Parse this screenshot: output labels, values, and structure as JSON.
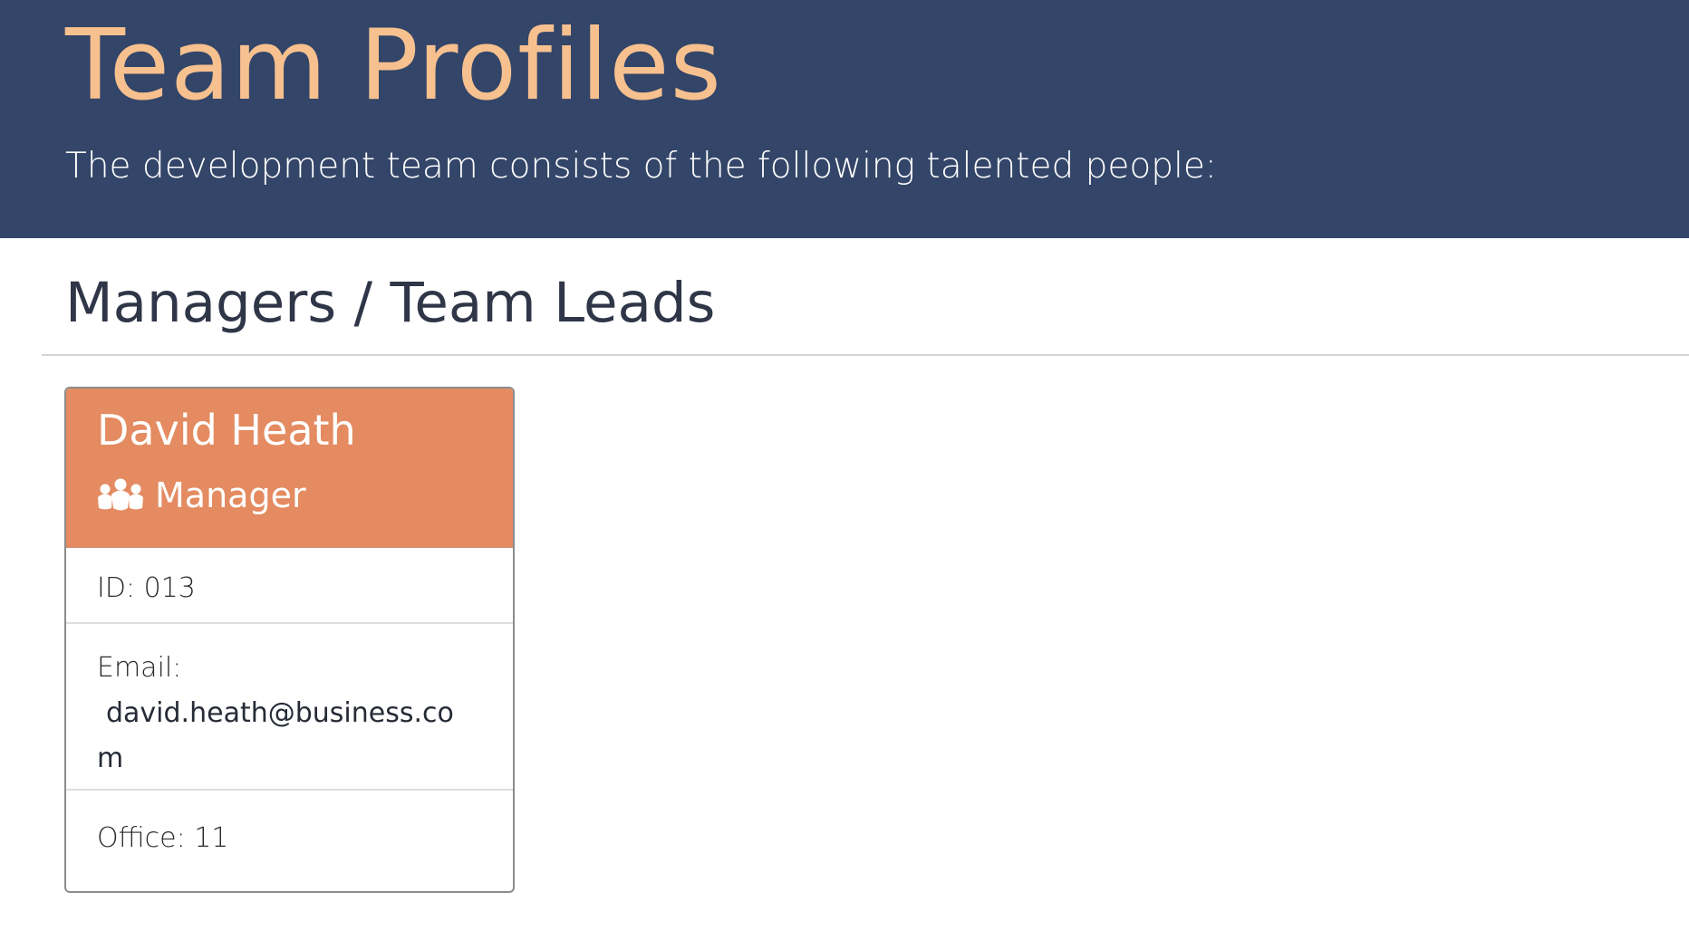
{
  "header": {
    "title": "Team Profiles",
    "subtitle": "The development team consists of the following talented people:"
  },
  "section": {
    "title": "Managers / Team Leads"
  },
  "cards": [
    {
      "name": "David Heath",
      "role_icon": "users-icon",
      "role": "Manager",
      "id_text": "ID: 013",
      "email_label": "Email:",
      "email": "david.heath@business.com",
      "office_text": "Office: 11"
    }
  ],
  "colors": {
    "header_background": "#334568",
    "title_accent": "#f6c08f",
    "card_header": "#e48b61",
    "text_dark": "#2f3647"
  }
}
